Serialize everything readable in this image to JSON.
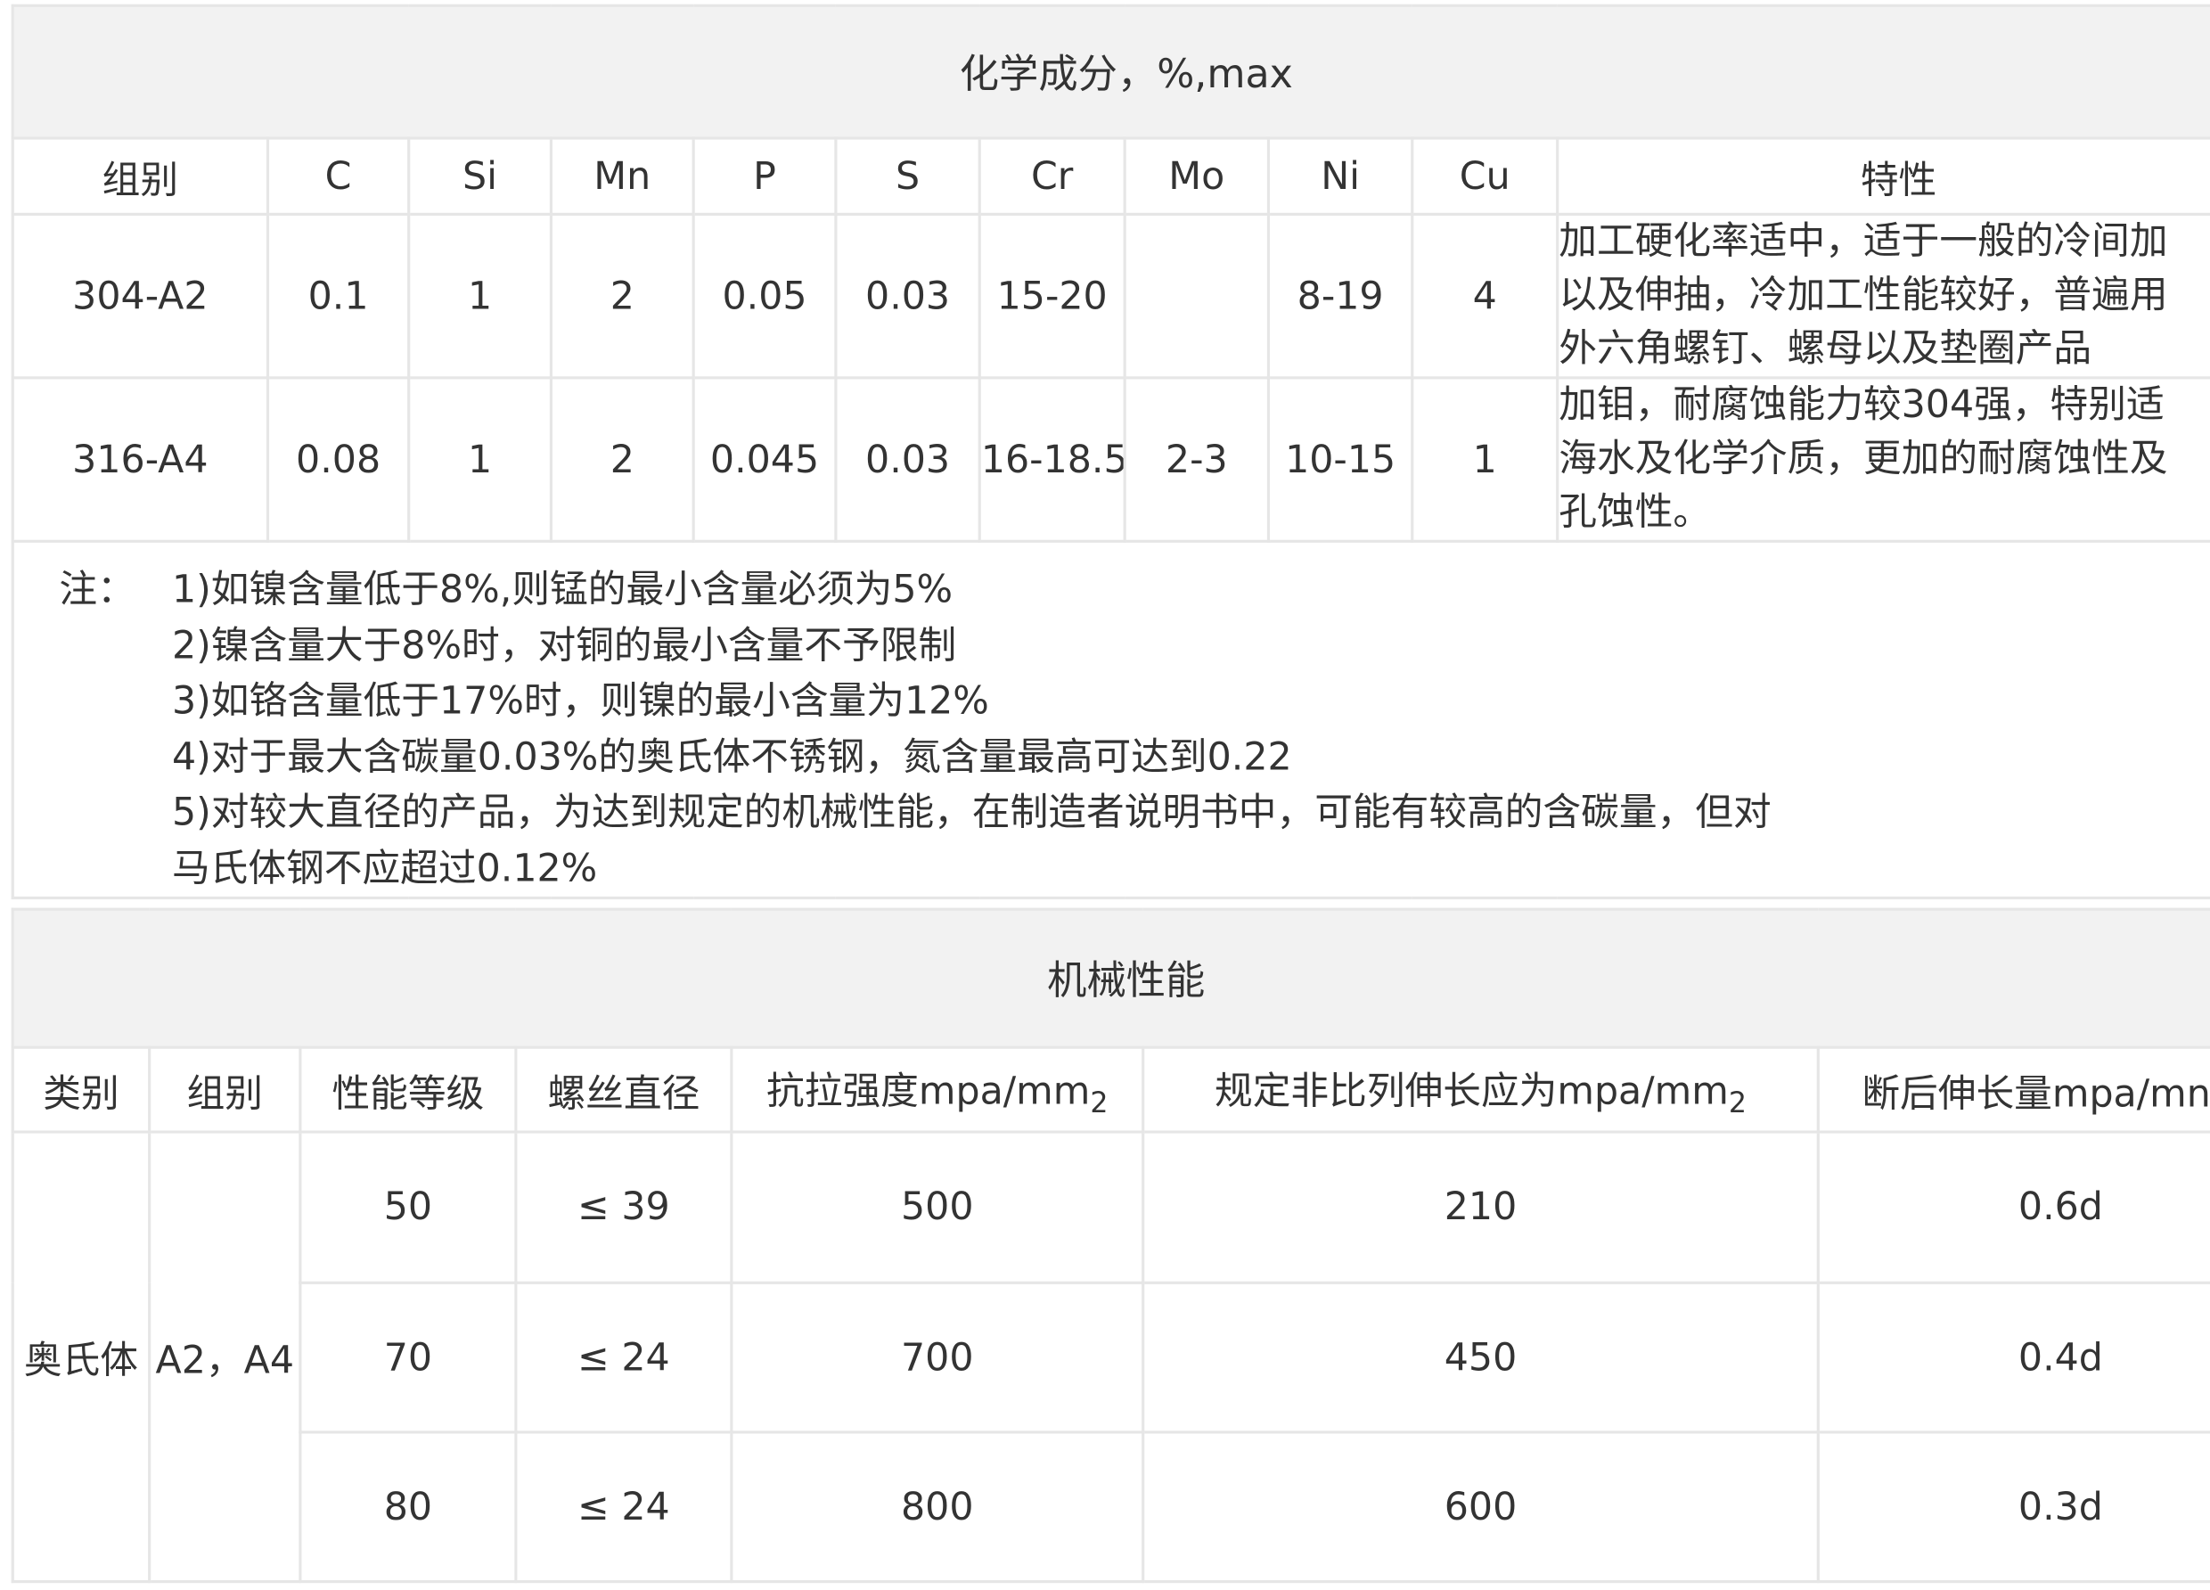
{
  "chem": {
    "title": "化学成分，%,max",
    "headers": [
      "组别",
      "C",
      "Si",
      "Mn",
      "P",
      "S",
      "Cr",
      "Mo",
      "Ni",
      "Cu",
      "特性"
    ],
    "rows": [
      {
        "cells": [
          "304-A2",
          "0.1",
          "1",
          "2",
          "0.05",
          "0.03",
          "15-20",
          "",
          "8-19",
          "4"
        ],
        "desc": [
          "加工硬化率适中，适于一般的冷间加",
          "以及伸抽，冷加工性能较好，普遍用",
          "外六角螺钉、螺母以及垫圈产品"
        ]
      },
      {
        "cells": [
          "316-A4",
          "0.08",
          "1",
          "2",
          "0.045",
          "0.03",
          "16-18.5",
          "2-3",
          "10-15",
          "1"
        ],
        "desc": [
          "加钼，耐腐蚀能力较304强，特别适",
          "海水及化学介质，更加的耐腐蚀性及",
          "孔蚀性。"
        ]
      }
    ],
    "note_label": "注：",
    "notes": [
      "1)如镍含量低于8%,则锰的最小含量必须为5%",
      "2)镍含量大于8%时，对铜的最小含量不予限制",
      "3)如铬含量低于17%时，则镍的最小含量为12%",
      "4)对于最大含碳量0.03%的奥氏体不锈钢，氮含量最高可达到0.22",
      "5)对较大直径的产品，为达到规定的机械性能，在制造者说明书中，可能有较高的含碳量，但对",
      "马氏体钢不应超过0.12%"
    ]
  },
  "mech": {
    "title": "机械性能",
    "headers": {
      "category": "类别",
      "group": "组别",
      "grade": "性能等级",
      "diameter": "螺丝直径",
      "tensile": "抗拉强度mpa/mm",
      "tensile_sub": "2",
      "yield": "规定非比列伸长应为mpa/mm",
      "yield_sub": "2",
      "elongation": "断后伸长量mpa/mn"
    },
    "category": "奥氏体",
    "group": "A2，A4",
    "rows": [
      {
        "grade": "50",
        "diameter": "≤ 39",
        "tensile": "500",
        "yield": "210",
        "elongation": "0.6d"
      },
      {
        "grade": "70",
        "diameter": "≤ 24",
        "tensile": "700",
        "yield": "450",
        "elongation": "0.4d"
      },
      {
        "grade": "80",
        "diameter": "≤ 24",
        "tensile": "800",
        "yield": "600",
        "elongation": "0.3d"
      }
    ]
  }
}
